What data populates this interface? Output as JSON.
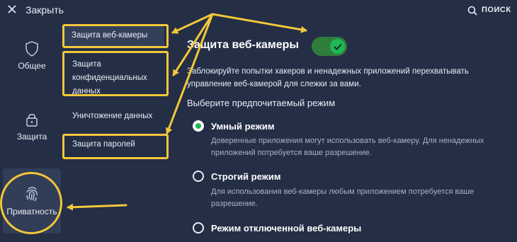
{
  "header": {
    "close_label": "Закрыть",
    "search_label": "ПОИСК"
  },
  "nav": {
    "items": [
      {
        "label": "Общее",
        "icon": "shield-icon"
      },
      {
        "label": "Защита",
        "icon": "lock-icon"
      },
      {
        "label": "Приватность",
        "icon": "fingerprint-icon",
        "active": true
      }
    ]
  },
  "submenu": {
    "items": [
      {
        "label": "Защита веб-камеры",
        "active": true
      },
      {
        "label": "Защита конфиденциальных данных"
      },
      {
        "label": "Уничтожение данных"
      },
      {
        "label": "Защита паролей"
      }
    ]
  },
  "main": {
    "title": "Защита веб-камеры",
    "toggle_on": true,
    "description": "Заблокируйте попытки хакеров и ненадежных приложений перехватывать управление веб-камерой для слежки за вами.",
    "choose_label": "Выберите предпочитаемый режим",
    "modes": [
      {
        "title": "Умный режим",
        "description": "Доверенные приложения могут использовать веб-камеру. Для ненадежных приложений потребуется ваше разрешение.",
        "selected": true
      },
      {
        "title": "Строгий режим",
        "description": "Для использования веб-камеры любым приложением потребуется ваше разрешение.",
        "selected": false
      },
      {
        "title": "Режим отключенной веб-камеры",
        "description": "",
        "selected": false
      }
    ]
  },
  "colors": {
    "background": "#242e45",
    "highlight": "#f2c73a",
    "accent_green": "#1db954"
  }
}
